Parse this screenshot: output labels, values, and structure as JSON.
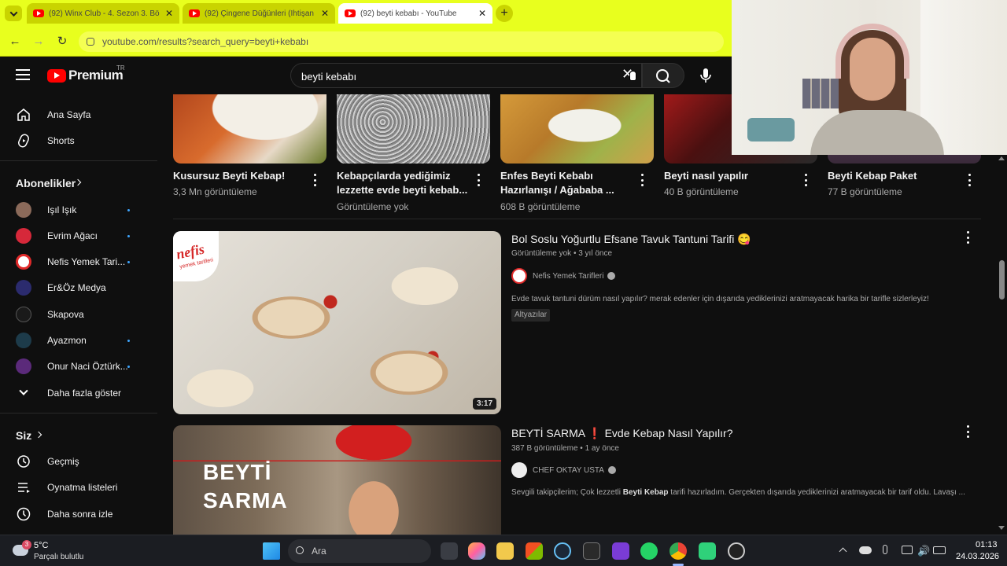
{
  "browser": {
    "tabs": [
      {
        "title": "(92) Winx Club - 4. Sezon 3. Bö",
        "active": false
      },
      {
        "title": "(92) Çingene Düğünleri (İhtişan",
        "active": false
      },
      {
        "title": "(92) beyti kebabı - YouTube",
        "active": true
      }
    ],
    "url": "youtube.com/results?search_query=beyti+kebabı"
  },
  "header": {
    "logo_text": "Premium",
    "region": "TR",
    "search_value": "beyti kebabı"
  },
  "sidebar": {
    "main": [
      {
        "label": "Ana Sayfa",
        "icon": "home-icon"
      },
      {
        "label": "Shorts",
        "icon": "shorts-icon"
      }
    ],
    "subscriptions_title": "Abonelikler",
    "subscriptions": [
      {
        "label": "Işıl Işık",
        "color": "#8b6a5a",
        "dot": true
      },
      {
        "label": "Evrim Ağacı",
        "color": "#d6283a",
        "dot": true
      },
      {
        "label": "Nefis Yemek Tari...",
        "color": "#ffffff",
        "dot": true
      },
      {
        "label": "Er&Öz Medya",
        "color": "#2b2b6e",
        "dot": false
      },
      {
        "label": "Skapova",
        "color": "#1a1a1a",
        "dot": false
      },
      {
        "label": "Ayazmon",
        "color": "#1d3b4a",
        "dot": true
      },
      {
        "label": "Onur Naci Öztürk...",
        "color": "#5b2a7a",
        "dot": true
      }
    ],
    "show_more": "Daha fazla göster",
    "you_title": "Siz",
    "you_items": [
      {
        "label": "Geçmiş",
        "icon": "history-icon"
      },
      {
        "label": "Oynatma listeleri",
        "icon": "playlists-icon"
      },
      {
        "label": "Daha sonra izle",
        "icon": "watch-later-icon"
      }
    ]
  },
  "shelf": [
    {
      "title": "Kusursuz Beyti Kebap!",
      "meta": "3,3 Mn görüntüleme"
    },
    {
      "title": "Kebapçılarda yediğimiz lezzette evde  beyti kebab...",
      "meta": "Görüntüleme yok"
    },
    {
      "title": "Enfes Beyti Kebabı Hazırlanışı / Ağababa ...",
      "meta": "608 B görüntüleme"
    },
    {
      "title": "Beyti nasıl yapılır",
      "meta": "40 B görüntüleme"
    },
    {
      "title": "Beyti Kebap Paket",
      "meta": "77 B görüntüleme"
    }
  ],
  "results": [
    {
      "title": "Bol Soslu Yoğurtlu Efsane Tavuk Tantuni Tarifi 😋",
      "views": "Görüntüleme yok",
      "age": "3 yıl önce",
      "channel": "Nefis Yemek Tarifleri",
      "description": "Evde tavuk tantuni dürüm nasıl yapılır? merak edenler için dışarıda yediklerinizi aratmayacak harika bir tarifle sizlerleyiz!",
      "chip": "Altyazılar",
      "duration": "3:17",
      "thumb_logo": "nefis",
      "thumb_logo_sub": "yemek tarifleri"
    },
    {
      "title": "BEYTİ SARMA",
      "title_mark": "❗",
      "title_rest": "Evde Kebap Nasıl Yapılır?",
      "views": "387 B görüntüleme",
      "age": "1 ay önce",
      "channel": "CHEF OKTAY USTA",
      "description_pre": "Sevgili takipçilerim; Çok lezzetli ",
      "description_bold": "Beyti Kebap",
      "description_post": " tarifi hazırladım. Gerçekten dışarıda yediklerinizi aratmayacak bir tarif oldu. Lavaşı ...",
      "thumb_text_1": "BEYTİ",
      "thumb_text_2": "SARMA"
    }
  ],
  "taskbar": {
    "weather_temp": "5°C",
    "weather_desc": "Parçalı bulutlu",
    "weather_badge": "3",
    "search_label": "Ara",
    "time": "01:13",
    "date": "24.03.2026"
  }
}
